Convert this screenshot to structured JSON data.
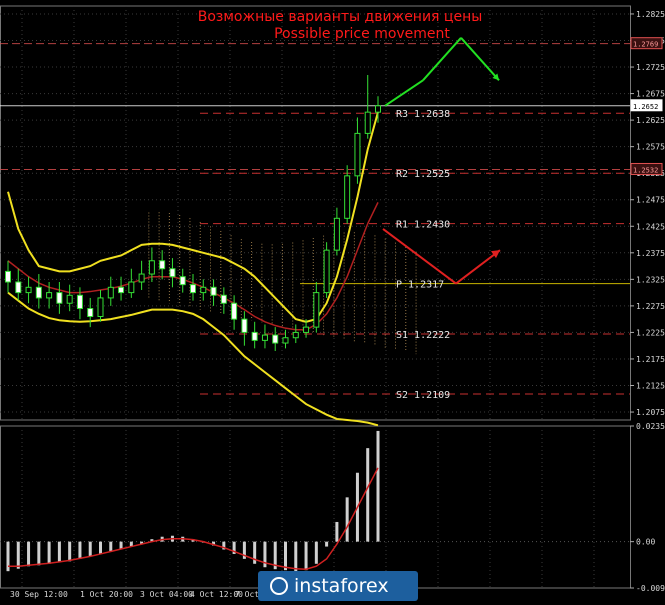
{
  "chart_data": [
    {
      "type": "candlestick",
      "title": "Возможные варианты движения цены",
      "subtitle": "Possible price movement",
      "ylim": [
        1.206,
        1.284
      ],
      "y_ticks": [
        "1.2825",
        "1.2775",
        "1.2725",
        "1.2675",
        "1.2625",
        "1.2575",
        "1.2525",
        "1.2475",
        "1.2425",
        "1.2375",
        "1.2325",
        "1.2275",
        "1.2225",
        "1.2175",
        "1.2125",
        "1.2075"
      ],
      "price_boxes": [
        {
          "label": "1.2769",
          "value": 1.2769,
          "color": "#e05050"
        },
        {
          "label": "1.2652",
          "value": 1.2652,
          "color": "#ffffff"
        },
        {
          "label": "1.2532",
          "value": 1.2532,
          "color": "#e05050"
        }
      ],
      "pivot_levels": [
        {
          "name": "R3",
          "label": "R3 1.2638",
          "value": 1.2638
        },
        {
          "name": "R2",
          "label": "R2 1.2525",
          "value": 1.2525
        },
        {
          "name": "R1",
          "label": "R1 1.2430",
          "value": 1.243
        },
        {
          "name": "P",
          "label": "P 1.2317",
          "value": 1.2317
        },
        {
          "name": "S1",
          "label": "S1 1.2222",
          "value": 1.2222
        },
        {
          "name": "S2",
          "label": "S2 1.2109",
          "value": 1.2109
        }
      ],
      "candles": [
        [
          1.234,
          1.232,
          1.236,
          1.23
        ],
        [
          1.232,
          1.23,
          1.2345,
          1.2285
        ],
        [
          1.23,
          1.231,
          1.233,
          1.228
        ],
        [
          1.231,
          1.229,
          1.2335,
          1.227
        ],
        [
          1.229,
          1.23,
          1.232,
          1.227
        ],
        [
          1.23,
          1.228,
          1.232,
          1.226
        ],
        [
          1.228,
          1.2295,
          1.2315,
          1.2265
        ],
        [
          1.2295,
          1.227,
          1.231,
          1.225
        ],
        [
          1.227,
          1.2255,
          1.229,
          1.2235
        ],
        [
          1.2255,
          1.229,
          1.2305,
          1.2245
        ],
        [
          1.229,
          1.231,
          1.233,
          1.2275
        ],
        [
          1.231,
          1.23,
          1.233,
          1.2285
        ],
        [
          1.23,
          1.232,
          1.2345,
          1.229
        ],
        [
          1.232,
          1.2335,
          1.236,
          1.2305
        ],
        [
          1.2335,
          1.236,
          1.2385,
          1.232
        ],
        [
          1.236,
          1.2345,
          1.238,
          1.2325
        ],
        [
          1.2345,
          1.233,
          1.2365,
          1.231
        ],
        [
          1.233,
          1.2315,
          1.2345,
          1.23
        ],
        [
          1.2315,
          1.23,
          1.2335,
          1.2285
        ],
        [
          1.23,
          1.231,
          1.2325,
          1.2285
        ],
        [
          1.231,
          1.2295,
          1.2325,
          1.2275
        ],
        [
          1.2295,
          1.228,
          1.231,
          1.226
        ],
        [
          1.228,
          1.225,
          1.2295,
          1.223
        ],
        [
          1.225,
          1.2225,
          1.2265,
          1.22
        ],
        [
          1.2225,
          1.221,
          1.2245,
          1.2195
        ],
        [
          1.221,
          1.222,
          1.224,
          1.2195
        ],
        [
          1.222,
          1.2205,
          1.2235,
          1.219
        ],
        [
          1.2205,
          1.2215,
          1.223,
          1.2195
        ],
        [
          1.2215,
          1.2225,
          1.224,
          1.2205
        ],
        [
          1.2225,
          1.2235,
          1.225,
          1.2215
        ],
        [
          1.2235,
          1.23,
          1.232,
          1.2225
        ],
        [
          1.23,
          1.238,
          1.2395,
          1.229
        ],
        [
          1.238,
          1.244,
          1.246,
          1.237
        ],
        [
          1.244,
          1.252,
          1.254,
          1.243
        ],
        [
          1.252,
          1.26,
          1.263,
          1.2505
        ],
        [
          1.26,
          1.264,
          1.271,
          1.259
        ],
        [
          1.264,
          1.2652,
          1.267,
          1.262
        ]
      ],
      "bollinger": {
        "upper": [
          1.249,
          1.242,
          1.238,
          1.235,
          1.2345,
          1.234,
          1.234,
          1.2345,
          1.235,
          1.236,
          1.2365,
          1.237,
          1.238,
          1.239,
          1.2392,
          1.2392,
          1.239,
          1.2385,
          1.238,
          1.2375,
          1.237,
          1.2365,
          1.2355,
          1.2345,
          1.233,
          1.231,
          1.229,
          1.227,
          1.225,
          1.2245,
          1.225,
          1.228,
          1.233,
          1.24,
          1.248,
          1.257,
          1.264
        ],
        "middle": [
          1.236,
          1.2345,
          1.233,
          1.2318,
          1.231,
          1.2305,
          1.23,
          1.23,
          1.2302,
          1.2305,
          1.2308,
          1.2312,
          1.2318,
          1.2325,
          1.233,
          1.233,
          1.233,
          1.2325,
          1.2318,
          1.231,
          1.23,
          1.229,
          1.228,
          1.2268,
          1.2255,
          1.2245,
          1.2238,
          1.2233,
          1.223,
          1.223,
          1.224,
          1.226,
          1.229,
          1.233,
          1.238,
          1.243,
          1.247
        ],
        "lower": [
          1.23,
          1.2285,
          1.227,
          1.226,
          1.2252,
          1.2248,
          1.2246,
          1.2245,
          1.2246,
          1.2248,
          1.225,
          1.2254,
          1.2258,
          1.2263,
          1.2268,
          1.2268,
          1.2268,
          1.2265,
          1.226,
          1.225,
          1.2235,
          1.222,
          1.22,
          1.218,
          1.2165,
          1.215,
          1.2135,
          1.212,
          1.2105,
          1.209,
          1.208,
          1.207,
          1.2062,
          1.206,
          1.2058,
          1.2055,
          1.205
        ]
      },
      "forecast_up": [
        [
          1.2652,
          1.27
        ],
        [
          1.27,
          1.278
        ],
        [
          1.278,
          1.27
        ]
      ],
      "forecast_down": [
        [
          1.242,
          1.2317
        ],
        [
          1.2317,
          1.238
        ]
      ]
    },
    {
      "type": "bar",
      "name": "oscillator",
      "ylim": [
        -0.00942,
        0.0235
      ],
      "y_ticks": [
        "0.0235",
        "0.00",
        "-0.00942"
      ],
      "values": [
        -0.006,
        -0.0055,
        -0.005,
        -0.0048,
        -0.0045,
        -0.0042,
        -0.004,
        -0.0035,
        -0.003,
        -0.0025,
        -0.002,
        -0.0015,
        -0.001,
        -0.0005,
        0.0005,
        0.001,
        0.0012,
        0.001,
        0.0005,
        0.0,
        -0.0008,
        -0.0016,
        -0.0025,
        -0.0035,
        -0.0045,
        -0.0052,
        -0.0056,
        -0.0058,
        -0.006,
        -0.0058,
        -0.0045,
        -0.001,
        0.004,
        0.009,
        0.014,
        0.019,
        0.0225
      ],
      "signal": [
        -0.005,
        -0.005,
        -0.0048,
        -0.0046,
        -0.0044,
        -0.0041,
        -0.0038,
        -0.0034,
        -0.003,
        -0.0025,
        -0.002,
        -0.0015,
        -0.001,
        -0.0005,
        0.0,
        0.0004,
        0.0006,
        0.0006,
        0.0004,
        0.0,
        -0.0006,
        -0.0012,
        -0.002,
        -0.0028,
        -0.0036,
        -0.0043,
        -0.0048,
        -0.0052,
        -0.0055,
        -0.0056,
        -0.005,
        -0.0035,
        -0.0005,
        0.003,
        0.007,
        0.011,
        0.015
      ],
      "x_ticks": [
        "30 Sep 12:00",
        "1 Oct 20:00",
        "3 Oct 04:00",
        "4 Oct 12:00",
        "7 Oct"
      ]
    }
  ],
  "watermark": {
    "brand": "instaforex"
  }
}
